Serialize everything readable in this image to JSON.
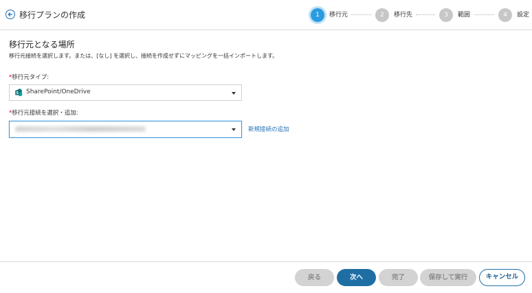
{
  "header": {
    "back_icon": "arrow-left-circle-icon",
    "title": "移行プランの作成"
  },
  "stepper": {
    "steps": [
      {
        "number": "1",
        "label": "移行元",
        "active": true
      },
      {
        "number": "2",
        "label": "移行先",
        "active": false
      },
      {
        "number": "3",
        "label": "範囲",
        "active": false
      },
      {
        "number": "4",
        "label": "設定",
        "active": false
      }
    ]
  },
  "main": {
    "title": "移行元となる場所",
    "description": "移行元接続を選択します。または、[なし] を選択し、接続を作成せずにマッピングを一括インポートします。",
    "source_type": {
      "required_mark": "*",
      "label": "移行元タイプ:",
      "value": "SharePoint/OneDrive",
      "icon": "sharepoint-icon"
    },
    "connection": {
      "required_mark": "*",
      "label": "移行元接続を選択・追加:",
      "value_blurred": true,
      "add_link": "新規接続の追加"
    }
  },
  "footer": {
    "back": "戻る",
    "next": "次へ",
    "finish": "完了",
    "save_run": "保存して実行",
    "cancel": "キャンセル"
  },
  "colors": {
    "accent": "#2a9be0",
    "primary_button": "#1f6ea3",
    "link": "#1e6fb3",
    "required": "#d0021b",
    "disabled": "#d3d3d3"
  }
}
